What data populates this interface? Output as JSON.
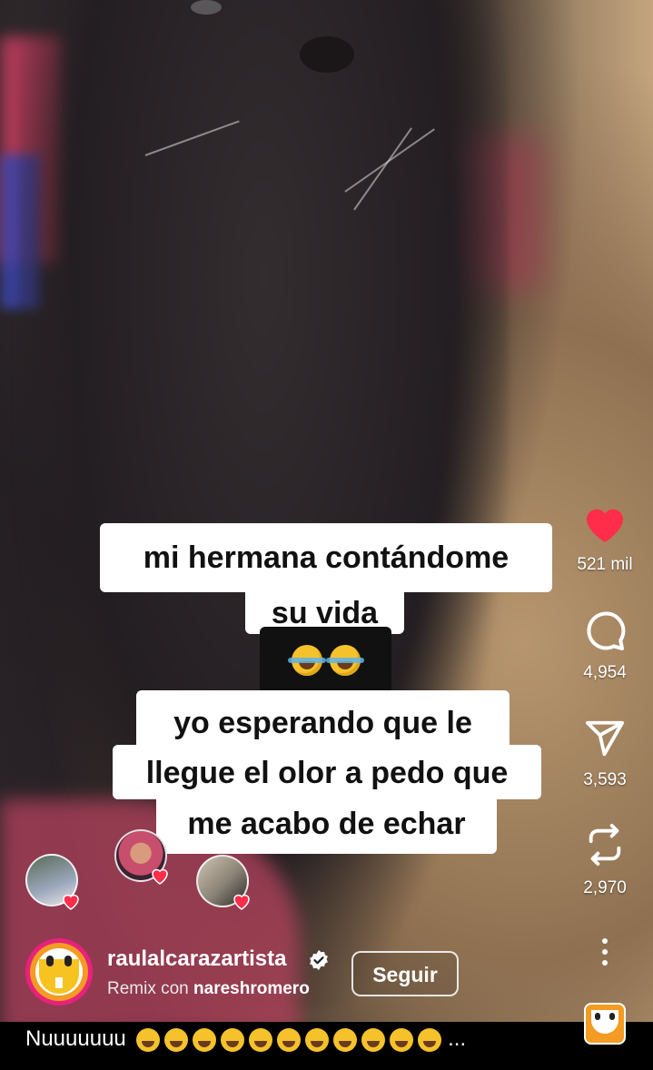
{
  "caption_sticker": {
    "line1": "mi hermana contándome",
    "line2": "su vida",
    "line3": "yo esperando que le",
    "line4": "llegue el olor a pedo que",
    "line5": "me acabo de echar"
  },
  "actions": {
    "like_count": "521 mil",
    "comment_count": "4,954",
    "share_count": "3,593",
    "repost_count": "2,970"
  },
  "author": {
    "username": "raulalcarazartista",
    "remix_prefix": "Remix con",
    "remix_user": "nareshromero",
    "follow_label": "Seguir"
  },
  "description": {
    "text": "Nuuuuuuu",
    "emoji_count": 11,
    "more": "..."
  },
  "colors": {
    "like": "#ff2d4a",
    "avatar_ring": "#e8217d",
    "avatar_fill": "#f39b22"
  },
  "icons": [
    "heart-icon",
    "comment-icon",
    "share-icon",
    "repost-icon",
    "more-icon",
    "verified-icon",
    "audio-icon"
  ]
}
